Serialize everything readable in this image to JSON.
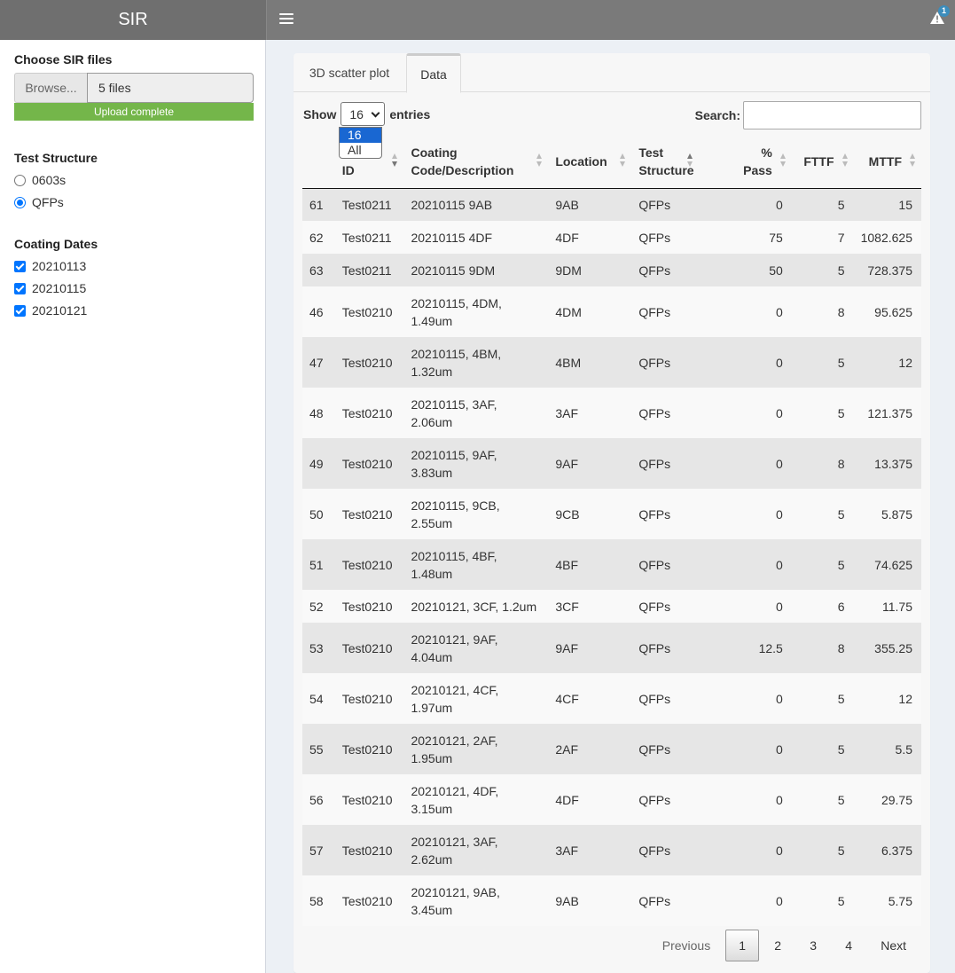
{
  "app": {
    "title": "SIR",
    "alert_count": "1"
  },
  "sidebar": {
    "file_label": "Choose SIR files",
    "browse_label": "Browse...",
    "file_value": "5 files",
    "upload_status": "Upload complete",
    "structure_label": "Test Structure",
    "structures": [
      {
        "label": "0603s",
        "selected": false
      },
      {
        "label": "QFPs",
        "selected": true
      }
    ],
    "dates_label": "Coating Dates",
    "dates": [
      {
        "label": "20210113",
        "checked": true
      },
      {
        "label": "20210115",
        "checked": true
      },
      {
        "label": "20210121",
        "checked": true
      }
    ]
  },
  "tabs": [
    {
      "label": "3D scatter plot",
      "active": false
    },
    {
      "label": "Data",
      "active": true
    }
  ],
  "table_controls": {
    "show_label": "Show",
    "entries_label": "entries",
    "length_value": "16",
    "length_options": [
      "16",
      "All"
    ],
    "search_label": "Search:",
    "search_value": ""
  },
  "columns": [
    "",
    "ID",
    "Coating Code/Description",
    "Location",
    "Test Structure",
    "% Pass",
    "FTTF",
    "MTTF"
  ],
  "rows": [
    [
      "61",
      "Test0211",
      "20210115 9AB",
      "9AB",
      "QFPs",
      "0",
      "5",
      "15"
    ],
    [
      "62",
      "Test0211",
      "20210115 4DF",
      "4DF",
      "QFPs",
      "75",
      "7",
      "1082.625"
    ],
    [
      "63",
      "Test0211",
      "20210115 9DM",
      "9DM",
      "QFPs",
      "50",
      "5",
      "728.375"
    ],
    [
      "46",
      "Test0210",
      "20210115, 4DM, 1.49um",
      "4DM",
      "QFPs",
      "0",
      "8",
      "95.625"
    ],
    [
      "47",
      "Test0210",
      "20210115, 4BM, 1.32um",
      "4BM",
      "QFPs",
      "0",
      "5",
      "12"
    ],
    [
      "48",
      "Test0210",
      "20210115, 3AF, 2.06um",
      "3AF",
      "QFPs",
      "0",
      "5",
      "121.375"
    ],
    [
      "49",
      "Test0210",
      "20210115, 9AF, 3.83um",
      "9AF",
      "QFPs",
      "0",
      "8",
      "13.375"
    ],
    [
      "50",
      "Test0210",
      "20210115, 9CB, 2.55um",
      "9CB",
      "QFPs",
      "0",
      "5",
      "5.875"
    ],
    [
      "51",
      "Test0210",
      "20210115, 4BF, 1.48um",
      "4BF",
      "QFPs",
      "0",
      "5",
      "74.625"
    ],
    [
      "52",
      "Test0210",
      "20210121, 3CF, 1.2um",
      "3CF",
      "QFPs",
      "0",
      "6",
      "11.75"
    ],
    [
      "53",
      "Test0210",
      "20210121, 9AF, 4.04um",
      "9AF",
      "QFPs",
      "12.5",
      "8",
      "355.25"
    ],
    [
      "54",
      "Test0210",
      "20210121, 4CF, 1.97um",
      "4CF",
      "QFPs",
      "0",
      "5",
      "12"
    ],
    [
      "55",
      "Test0210",
      "20210121, 2AF, 1.95um",
      "2AF",
      "QFPs",
      "0",
      "5",
      "5.5"
    ],
    [
      "56",
      "Test0210",
      "20210121, 4DF, 3.15um",
      "4DF",
      "QFPs",
      "0",
      "5",
      "29.75"
    ],
    [
      "57",
      "Test0210",
      "20210121, 3AF, 2.62um",
      "3AF",
      "QFPs",
      "0",
      "5",
      "6.375"
    ],
    [
      "58",
      "Test0210",
      "20210121, 9AB, 3.45um",
      "9AB",
      "QFPs",
      "0",
      "5",
      "5.75"
    ]
  ],
  "pagination": {
    "previous": "Previous",
    "pages": [
      "1",
      "2",
      "3",
      "4"
    ],
    "current": "1",
    "next": "Next"
  }
}
